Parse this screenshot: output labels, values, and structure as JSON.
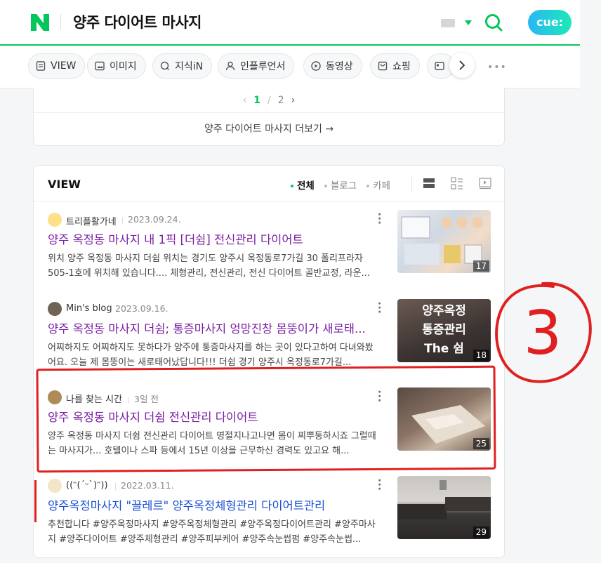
{
  "header": {
    "query": "양주 다이어트 마사지",
    "cue_label": "cue:"
  },
  "tabs": [
    {
      "label": "VIEW",
      "icon": "doc-icon"
    },
    {
      "label": "이미지",
      "icon": "image-icon"
    },
    {
      "label": "지식iN",
      "icon": "q-icon"
    },
    {
      "label": "인플루언서",
      "icon": "person-icon"
    },
    {
      "label": "동영상",
      "icon": "play-icon"
    },
    {
      "label": "쇼핑",
      "icon": "bag-icon"
    }
  ],
  "pager": {
    "current": "1",
    "sep": "/",
    "total": "2"
  },
  "more_link": "양주 다이어트 마사지 더보기 →",
  "view": {
    "title": "VIEW",
    "filters": [
      "전체",
      "블로그",
      "카페"
    ]
  },
  "items": [
    {
      "author": "트리플활가네",
      "date": "2023.09.24.",
      "title": "양주 옥정동 마사지 내 1픽 [더쉼] 전신관리 다이어트",
      "desc": "위치 양주 옥정동 마사지 더쉼 위치는 경기도 양주시 옥정동로7가길 30 폴리프라자 505-1호에 위치해 있습니다.... 체형관리, 전신관리, 전신 다이어트 골반교정, 라운...",
      "count": "17"
    },
    {
      "author": "Min's blog",
      "date": "2023.09.16.",
      "title": "양주 옥정동 마사지 더쉼; 통증마사지 엉망진창 몸뚱이가 새로태...",
      "desc": "어찌하지도 어찌하지도 못하다가 양주에 통증마사지를 하는 곳이 있다고하여 다녀와봤어요. 오늘 제 몸뚱이는 새로태어났답니다!!! 더쉼 경기 양주시 옥정동로7가길...",
      "count": "18",
      "thumb_text": [
        "양주옥정",
        "통증관리",
        "The 쉼"
      ]
    },
    {
      "author": "나를 찾는 시간",
      "date": "3일 전",
      "title": "양주 옥정동 마사지 더쉼 전신관리 다이어트",
      "desc": "양주 옥정동 마사지 더쉼 전신관리 다이어트 명절지나고나면 몸이 찌뿌둥하시죠 그럴때는 마사지가... 호텔이나 스파 등에서 15년 이상을 근무하신 경력도 있고요 해...",
      "count": "25"
    },
    {
      "author": "((ᵔ(ˊᵕˋ)ᵔ))",
      "date": "2022.03.11.",
      "title": "양주옥정마사지 \"끌레르\" 양주옥정체형관리 다이어트관리",
      "desc": "추천합니다 #양주옥정마사지 #양주옥정체형관리 #양주옥정다이어트관리 #양주마사지 #양주다이어트 #양주체형관리 #양주피부케어 #양주속눈썹펌 #양주속눈썹...",
      "count": "29"
    }
  ],
  "annotation": {
    "label": "3",
    "color": "#e02020"
  },
  "colors": {
    "brand_green": "#03c75a",
    "title_purple": "#7a1fa2",
    "title_blue": "#1a4fd6"
  }
}
